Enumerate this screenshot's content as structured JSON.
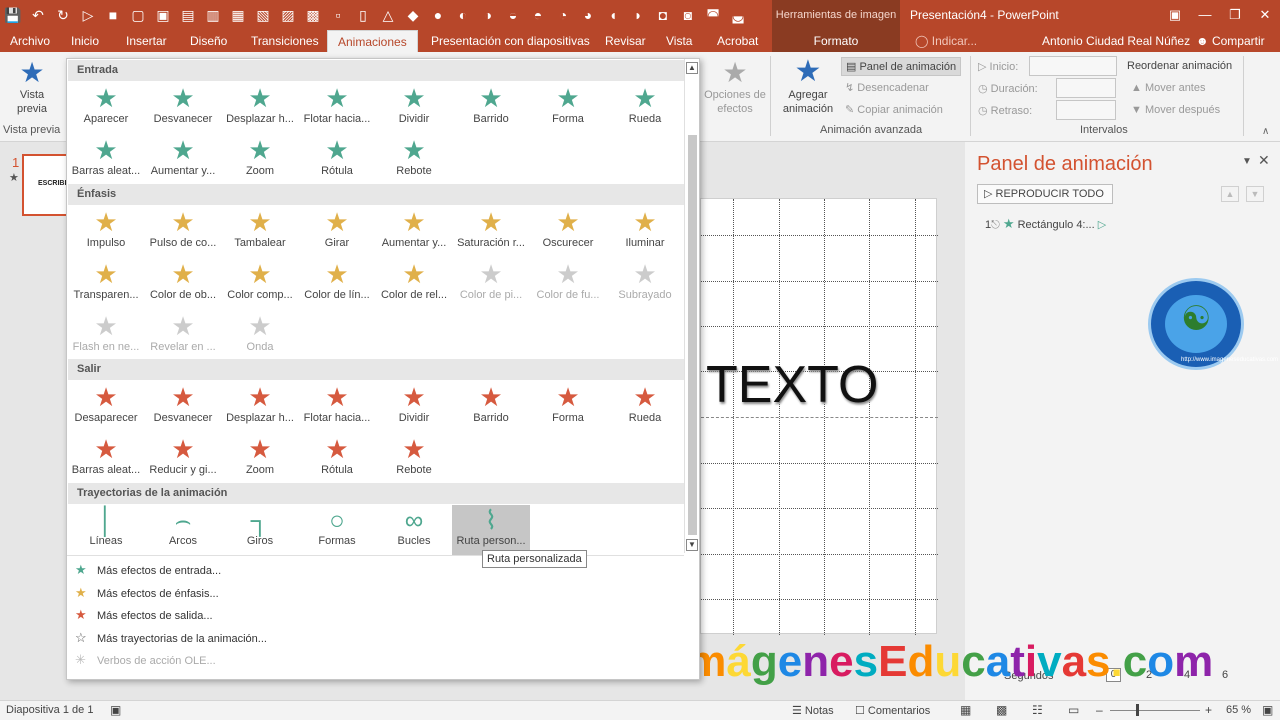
{
  "qat": {
    "icons": [
      "save-icon",
      "undo-icon",
      "redo-icon",
      "start-icon"
    ]
  },
  "title": {
    "context_group": "Herramientas de imagen",
    "document": "Presentación4 - PowerPoint"
  },
  "tabs": [
    "Archivo",
    "Inicio",
    "Insertar",
    "Diseño",
    "Transiciones",
    "Animaciones",
    "Presentación con diapositivas",
    "Revisar",
    "Vista",
    "Acrobat"
  ],
  "context_tab": "Formato",
  "tellme": "Indicar...",
  "user": "Antonio Ciudad Real Núñez",
  "share": "Compartir",
  "ribbon": {
    "preview_label": "Vista\nprevia",
    "preview_group": "Vista previa",
    "effect_options": "Opciones de\nefectos",
    "add_anim": "Agregar\nanimación",
    "panel": "Panel de animación",
    "trigger": "Desencadenar",
    "copy_anim": "Copiar animación",
    "adv_group": "Animación avanzada",
    "start": "Inicio:",
    "duration": "Duración:",
    "delay": "Retraso:",
    "intervals": "Intervalos",
    "reorder": "Reordenar animación",
    "move_earlier": "Mover antes",
    "move_later": "Mover después"
  },
  "gallery": {
    "sections": [
      "Entrada",
      "Énfasis",
      "Salir",
      "Trayectorias de la animación"
    ],
    "entrada": [
      "Aparecer",
      "Desvanecer",
      "Desplazar h...",
      "Flotar hacia...",
      "Dividir",
      "Barrido",
      "Forma",
      "Rueda",
      "Barras aleat...",
      "Aumentar y...",
      "Zoom",
      "Rótula",
      "Rebote"
    ],
    "enfasis": [
      "Impulso",
      "Pulso de co...",
      "Tambalear",
      "Girar",
      "Aumentar y...",
      "Saturación r...",
      "Oscurecer",
      "Iluminar",
      "Transparen...",
      "Color de ob...",
      "Color comp...",
      "Color de lín...",
      "Color de rel...",
      "Color de pi...",
      "Color de fu...",
      "Subrayado",
      "Flash en ne...",
      "Revelar en ...",
      "Onda"
    ],
    "salir": [
      "Desaparecer",
      "Desvanecer",
      "Desplazar h...",
      "Flotar hacia...",
      "Dividir",
      "Barrido",
      "Forma",
      "Rueda",
      "Barras aleat...",
      "Reducir y gi...",
      "Zoom",
      "Rótula",
      "Rebote"
    ],
    "trayectorias": [
      "Líneas",
      "Arcos",
      "Giros",
      "Formas",
      "Bucles",
      "Ruta person..."
    ],
    "more": [
      "Más efectos de entrada...",
      "Más efectos de énfasis...",
      "Más efectos de salida...",
      "Más trayectorias de la animación...",
      "Verbos de acción OLE..."
    ]
  },
  "tooltip": "Ruta personalizada",
  "slide": {
    "number": "1",
    "text": "TEXTO",
    "thumb_text": "ESCRIBI"
  },
  "anim_pane": {
    "title": "Panel de animación",
    "play_all": "REPRODUCIR TODO",
    "item_num": "1",
    "item_name": "Rectángulo 4:..."
  },
  "timeline": {
    "label": "Segundos",
    "t0": "0",
    "t2": "2",
    "t4": "4",
    "t6": "6"
  },
  "status": {
    "slide": "Diapositiva 1 de 1",
    "notes": "Notas",
    "comments": "Comentarios",
    "zoom": "65 %"
  },
  "watermark": "ImágenesEducativas.com",
  "logo_text": "http://www.imageneseducativas.com",
  "colors": {
    "accent": "#b7472a",
    "entrance": "#4fa78f",
    "emphasis": "#e0b04a",
    "exit": "#d65a3f"
  }
}
